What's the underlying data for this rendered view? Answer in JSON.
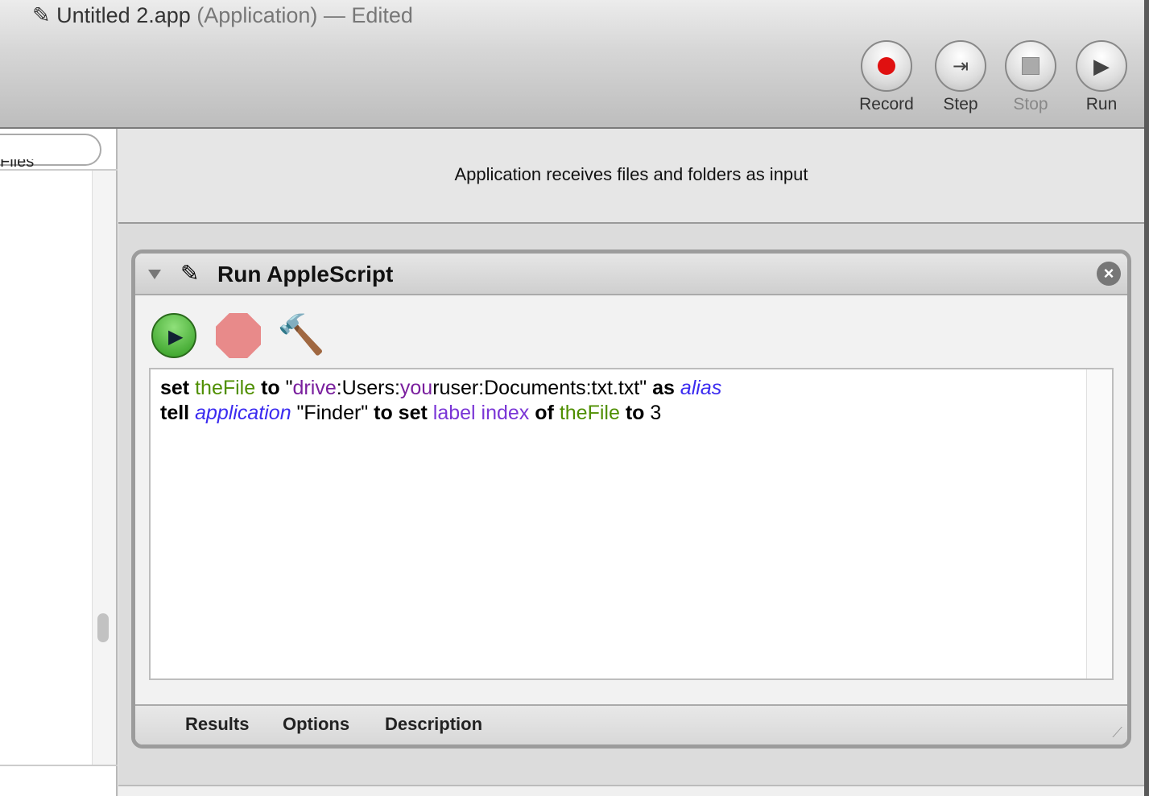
{
  "window": {
    "title": "Untitled 2.app",
    "title_suffix": "(Application) — Edited"
  },
  "toolbar": {
    "record": "Record",
    "step": "Step",
    "stop": "Stop",
    "run": "Run"
  },
  "sidebar": {
    "partial_item": "Files"
  },
  "workflow": {
    "input_text": "Application receives files and folders as input"
  },
  "action": {
    "title": "Run AppleScript",
    "code": [
      [
        {
          "t": "set",
          "c": "kw"
        },
        {
          "t": " "
        },
        {
          "t": "theFile",
          "c": "var"
        },
        {
          "t": " "
        },
        {
          "t": "to",
          "c": "kw"
        },
        {
          "t": " \""
        },
        {
          "t": "drive",
          "c": "lit"
        },
        {
          "t": ":Users:"
        },
        {
          "t": "you",
          "c": "lit"
        },
        {
          "t": "ruser:Documents:txt.txt\" "
        },
        {
          "t": "as",
          "c": "kw"
        },
        {
          "t": " "
        },
        {
          "t": "alias",
          "c": "cls"
        }
      ],
      [
        {
          "t": "tell",
          "c": "kw"
        },
        {
          "t": " "
        },
        {
          "t": "application",
          "c": "cls"
        },
        {
          "t": " \"Finder\" "
        },
        {
          "t": "to set",
          "c": "kw"
        },
        {
          "t": " "
        },
        {
          "t": "label index",
          "c": "prop"
        },
        {
          "t": " "
        },
        {
          "t": "of",
          "c": "kw"
        },
        {
          "t": " "
        },
        {
          "t": "theFile",
          "c": "var"
        },
        {
          "t": " "
        },
        {
          "t": "to",
          "c": "kw"
        },
        {
          "t": " 3"
        }
      ]
    ],
    "tabs": [
      "Results",
      "Options",
      "Description"
    ]
  },
  "colors": {
    "record": "#e01010",
    "variable": "#4f8f00",
    "class": "#3b2bf0",
    "property": "#7a35d6"
  }
}
